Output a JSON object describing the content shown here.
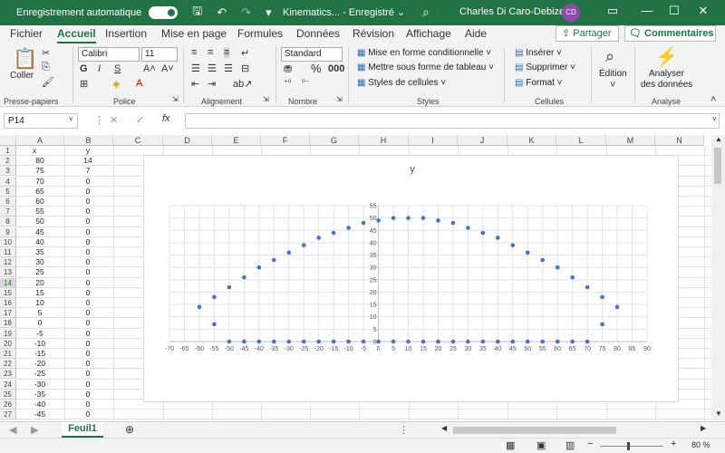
{
  "titlebar": {
    "autosave_label": "Enregistrement automatique",
    "doc_title": "Kinematics... - Enregistré",
    "doc_title_chevron": "⌄",
    "username": "Charles Di Caro-Debizet",
    "avatar_initials": "CD"
  },
  "tabs": [
    "Fichier",
    "Accueil",
    "Insertion",
    "Mise en page",
    "Formules",
    "Données",
    "Révision",
    "Affichage",
    "Aide"
  ],
  "active_tab": "Accueil",
  "share_label": "Partager",
  "comments_label": "Commentaires",
  "ribbon": {
    "paste_label": "Coller",
    "font_name": "Calibri",
    "font_size": "11",
    "number_format": "Standard",
    "conditional_format": "Mise en forme conditionnelle",
    "format_table": "Mettre sous forme de tableau",
    "cell_styles": "Styles de cellules",
    "insert": "Insérer",
    "delete": "Supprimer",
    "format": "Format",
    "edition": "Édition",
    "analyze_line1": "Analyser",
    "analyze_line2": "des données",
    "groups": {
      "clipboard": "Presse-papiers",
      "font": "Police",
      "alignment": "Alignement",
      "number": "Nombre",
      "styles": "Styles",
      "cells": "Cellules",
      "analysis": "Analyse"
    }
  },
  "formula_bar": {
    "name_box": "P14",
    "formula": ""
  },
  "columns": [
    "A",
    "B",
    "C",
    "D",
    "E",
    "F",
    "G",
    "H",
    "I",
    "J",
    "K",
    "L",
    "M",
    "N"
  ],
  "rows": [
    {
      "n": "1",
      "a": "x",
      "b": "y"
    },
    {
      "n": "2",
      "a": "80",
      "b": "14"
    },
    {
      "n": "3",
      "a": "75",
      "b": "7"
    },
    {
      "n": "4",
      "a": "70",
      "b": "0"
    },
    {
      "n": "5",
      "a": "65",
      "b": "0"
    },
    {
      "n": "6",
      "a": "60",
      "b": "0"
    },
    {
      "n": "7",
      "a": "55",
      "b": "0"
    },
    {
      "n": "8",
      "a": "50",
      "b": "0"
    },
    {
      "n": "9",
      "a": "45",
      "b": "0"
    },
    {
      "n": "10",
      "a": "40",
      "b": "0"
    },
    {
      "n": "11",
      "a": "35",
      "b": "0"
    },
    {
      "n": "12",
      "a": "30",
      "b": "0"
    },
    {
      "n": "13",
      "a": "25",
      "b": "0"
    },
    {
      "n": "14",
      "a": "20",
      "b": "0"
    },
    {
      "n": "15",
      "a": "15",
      "b": "0"
    },
    {
      "n": "16",
      "a": "10",
      "b": "0"
    },
    {
      "n": "17",
      "a": "5",
      "b": "0"
    },
    {
      "n": "18",
      "a": "0",
      "b": "0"
    },
    {
      "n": "19",
      "a": "-5",
      "b": "0"
    },
    {
      "n": "20",
      "a": "-10",
      "b": "0"
    },
    {
      "n": "21",
      "a": "-15",
      "b": "0"
    },
    {
      "n": "22",
      "a": "-20",
      "b": "0"
    },
    {
      "n": "23",
      "a": "-25",
      "b": "0"
    },
    {
      "n": "24",
      "a": "-30",
      "b": "0"
    },
    {
      "n": "25",
      "a": "-35",
      "b": "0"
    },
    {
      "n": "26",
      "a": "-40",
      "b": "0"
    },
    {
      "n": "27",
      "a": "-45",
      "b": "0"
    }
  ],
  "selected_row": "14",
  "sheet_tab": "Feuil1",
  "zoom": "80 %",
  "chart_data": {
    "type": "scatter",
    "title": "y",
    "xlim": [
      -70,
      90
    ],
    "ylim": [
      0,
      55
    ],
    "xticks": [
      -70,
      -65,
      -60,
      -55,
      -50,
      -45,
      -40,
      -35,
      -30,
      -25,
      -20,
      -15,
      -10,
      -5,
      0,
      5,
      10,
      15,
      20,
      25,
      30,
      35,
      40,
      45,
      50,
      55,
      60,
      65,
      70,
      75,
      80,
      85,
      90
    ],
    "yticks": [
      0,
      5,
      10,
      15,
      20,
      25,
      30,
      35,
      40,
      45,
      50,
      55
    ],
    "grid": true,
    "series": [
      {
        "color": "#4472c4",
        "x": [
          -60,
          -55,
          -55,
          -50,
          -45,
          -40,
          -35,
          -30,
          -25,
          -20,
          -15,
          -10,
          -5,
          0,
          5,
          10,
          15,
          20,
          25,
          30,
          35,
          40,
          45,
          50,
          55,
          60,
          65,
          70,
          75,
          75,
          80,
          -50,
          -45,
          -40,
          -35,
          -30,
          -25,
          -20,
          -15,
          -10,
          -5,
          0,
          5,
          10,
          15,
          20,
          25,
          30,
          35,
          40,
          45,
          50,
          55,
          60,
          65,
          70
        ],
        "y": [
          14,
          7,
          18,
          22,
          26,
          30,
          33,
          36,
          39,
          42,
          44,
          46,
          48,
          49,
          50,
          50,
          50,
          49,
          48,
          46,
          44,
          42,
          39,
          36,
          33,
          30,
          26,
          22,
          18,
          7,
          14,
          0,
          0,
          0,
          0,
          0,
          0,
          0,
          0,
          0,
          0,
          0,
          0,
          0,
          0,
          0,
          0,
          0,
          0,
          0,
          0,
          0,
          0,
          0,
          0,
          0
        ]
      }
    ]
  }
}
